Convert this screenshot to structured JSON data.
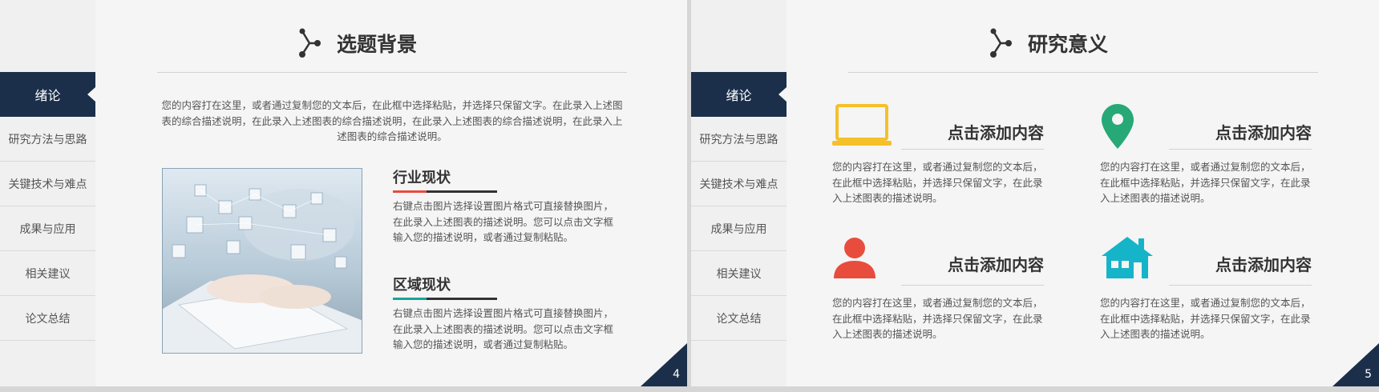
{
  "sidebar": {
    "items": [
      {
        "label": "绪论",
        "active": true
      },
      {
        "label": "研究方法与思路",
        "active": false
      },
      {
        "label": "关键技术与难点",
        "active": false
      },
      {
        "label": "成果与应用",
        "active": false
      },
      {
        "label": "相关建议",
        "active": false
      },
      {
        "label": "论文总结",
        "active": false
      }
    ]
  },
  "colors": {
    "navy": "#1b2f4a",
    "red": "#e84c3d",
    "teal": "#1aa398",
    "yellow": "#f5c02a",
    "green": "#27a877",
    "cyan": "#16b4c8"
  },
  "slide4": {
    "title": "选题背景",
    "intro": "您的内容打在这里，或者通过复制您的文本后，在此框中选择粘贴，并选择只保留文字。在此录入上述图表的综合描述说明，在此录入上述图表的综合描述说明，在此录入上述图表的综合描述说明，在此录入上述图表的综合描述说明。",
    "sections": [
      {
        "title": "行业现状",
        "body": "右键点击图片选择设置图片格式可直接替换图片，在此录入上述图表的描述说明。您可以点击文字框输入您的描述说明，或者通过复制粘贴。"
      },
      {
        "title": "区域现状",
        "body": "右键点击图片选择设置图片格式可直接替换图片，在此录入上述图表的描述说明。您可以点击文字框输入您的描述说明，或者通过复制粘贴。"
      }
    ],
    "page_number": "4"
  },
  "slide5": {
    "title": "研究意义",
    "features": [
      {
        "icon": "laptop-icon",
        "title": "点击添加内容",
        "body": "您的内容打在这里，或者通过复制您的文本后，在此框中选择粘贴，并选择只保留文字，在此录入上述图表的描述说明。"
      },
      {
        "icon": "location-pin-icon",
        "title": "点击添加内容",
        "body": "您的内容打在这里，或者通过复制您的文本后，在此框中选择粘贴，并选择只保留文字，在此录入上述图表的描述说明。"
      },
      {
        "icon": "person-icon",
        "title": "点击添加内容",
        "body": "您的内容打在这里，或者通过复制您的文本后，在此框中选择粘贴，并选择只保留文字，在此录入上述图表的描述说明。"
      },
      {
        "icon": "house-icon",
        "title": "点击添加内容",
        "body": "您的内容打在这里，或者通过复制您的文本后，在此框中选择粘贴，并选择只保留文字，在此录入上述图表的描述说明。"
      }
    ],
    "page_number": "5"
  }
}
